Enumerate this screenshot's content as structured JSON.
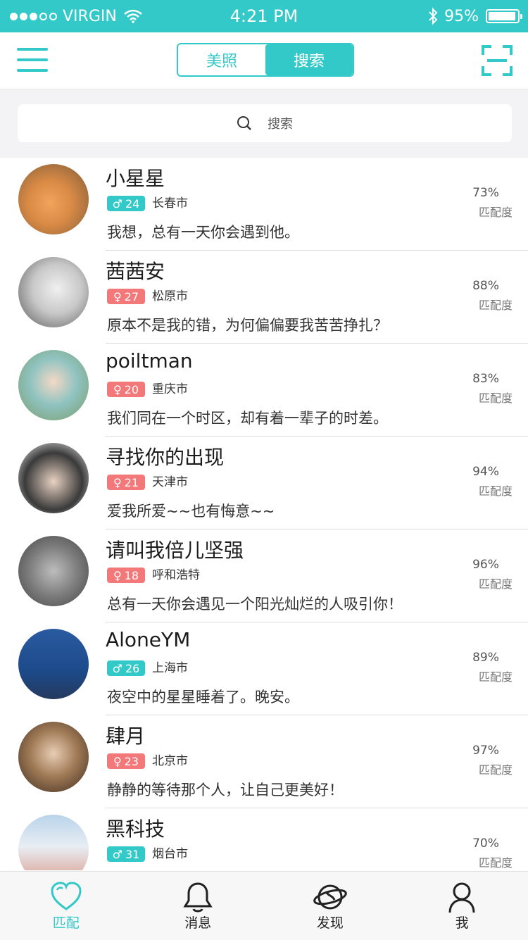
{
  "status_bar": {
    "carrier": "VIRGIN",
    "time": "4:21 PM",
    "battery": "95%",
    "battery_level": 0.95
  },
  "header": {
    "segments": [
      "美照",
      "搜索"
    ],
    "active_segment": 1
  },
  "search": {
    "placeholder": "搜索"
  },
  "match_label": "匹配度",
  "contacts": [
    {
      "name": "小星星",
      "gender": "male",
      "gender_icon": "male-icon",
      "age": "24",
      "city": "长春市",
      "message": "我想，总有一天你会遇到他。",
      "match": "73%"
    },
    {
      "name": "茜茜安",
      "gender": "female",
      "gender_icon": "female-icon",
      "age": "27",
      "city": "松原市",
      "message": "原本不是我的错，为何偏偏要我苦苦挣扎？",
      "match": "88%"
    },
    {
      "name": "poiltman",
      "gender": "female",
      "gender_icon": "female-icon",
      "age": "20",
      "city": "重庆市",
      "message": "我们同在一个时区，却有着一辈子的时差。",
      "match": "83%"
    },
    {
      "name": "寻找你的出现",
      "gender": "female",
      "gender_icon": "female-icon",
      "age": "21",
      "city": "天津市",
      "message": "爱我所爱~~也有悔意~~",
      "match": "94%"
    },
    {
      "name": "请叫我倍儿坚强",
      "gender": "female",
      "gender_icon": "female-icon",
      "age": "18",
      "city": "呼和浩特",
      "message": "总有一天你会遇见一个阳光灿烂的人吸引你！",
      "match": "96%"
    },
    {
      "name": "AloneYM",
      "gender": "male",
      "gender_icon": "male-icon",
      "age": "26",
      "city": "上海市",
      "message": "夜空中的星星睡着了。晚安。",
      "match": "89%"
    },
    {
      "name": "肆月",
      "gender": "female",
      "gender_icon": "female-icon",
      "age": "23",
      "city": "北京市",
      "message": "静静的等待那个人，让自己更美好！",
      "match": "97%"
    },
    {
      "name": "黑科技",
      "gender": "male",
      "gender_icon": "male-icon",
      "age": "31",
      "city": "烟台市",
      "message": "",
      "match": "70%"
    }
  ],
  "tabs": [
    {
      "label": "匹配",
      "icon": "heart-icon",
      "active": true
    },
    {
      "label": "消息",
      "icon": "bell-icon",
      "active": false
    },
    {
      "label": "发现",
      "icon": "planet-icon",
      "active": false
    },
    {
      "label": "我",
      "icon": "user-icon",
      "active": false
    }
  ],
  "colors": {
    "accent": "#33c9c8",
    "male": "#33c9c8",
    "female": "#f3787a"
  }
}
